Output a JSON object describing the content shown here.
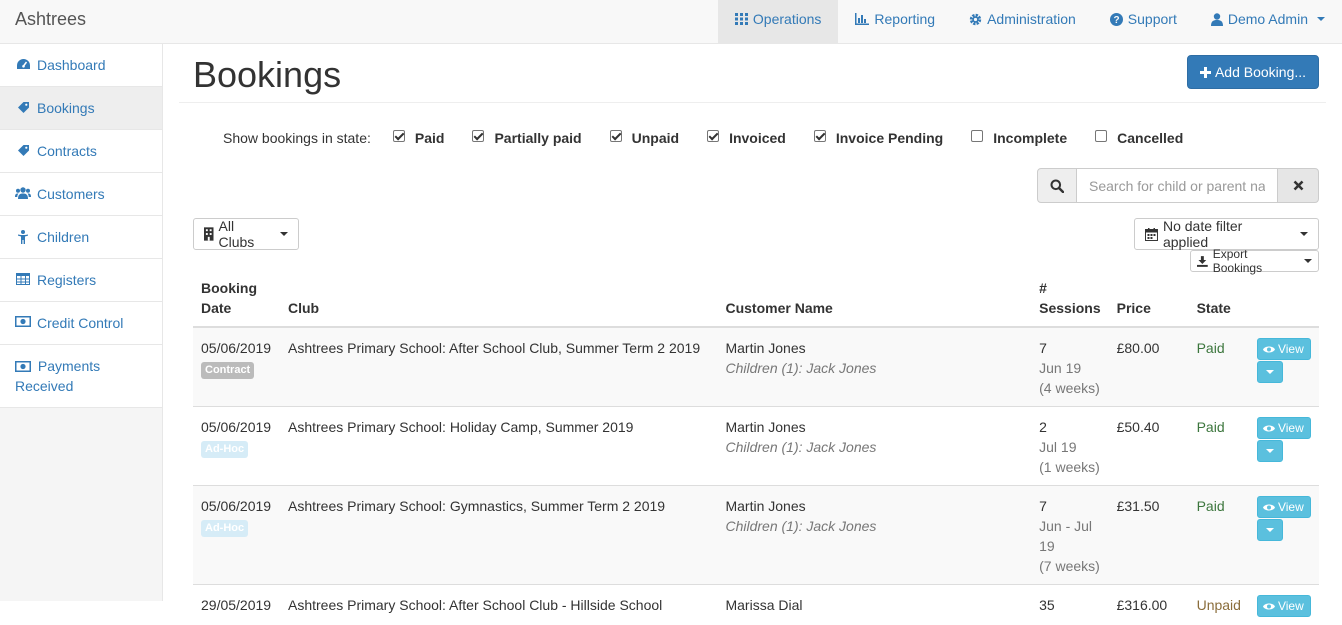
{
  "app": {
    "brand": "Ashtrees"
  },
  "nav": {
    "items": [
      {
        "label": "Operations",
        "icon": "grid-icon",
        "active": true
      },
      {
        "label": "Reporting",
        "icon": "bar-chart-icon"
      },
      {
        "label": "Administration",
        "icon": "gear-icon"
      },
      {
        "label": "Support",
        "icon": "question-circle-icon"
      },
      {
        "label": "Demo Admin",
        "icon": "user-icon"
      }
    ]
  },
  "sidebar": {
    "items": [
      {
        "label": "Dashboard",
        "icon": "dashboard-icon"
      },
      {
        "label": "Bookings",
        "icon": "tag-icon",
        "active": true
      },
      {
        "label": "Contracts",
        "icon": "tags-icon"
      },
      {
        "label": "Customers",
        "icon": "users-icon"
      },
      {
        "label": "Children",
        "icon": "child-icon"
      },
      {
        "label": "Registers",
        "icon": "table-icon"
      },
      {
        "label": "Credit Control",
        "icon": "money-icon"
      },
      {
        "label": "Payments Received",
        "icon": "money-icon"
      }
    ]
  },
  "page": {
    "title": "Bookings",
    "add_button": "Add Booking...",
    "filter_label": "Show bookings in state:",
    "states": [
      {
        "label": "Paid",
        "checked": true
      },
      {
        "label": "Partially paid",
        "checked": true
      },
      {
        "label": "Unpaid",
        "checked": true
      },
      {
        "label": "Invoiced",
        "checked": true
      },
      {
        "label": "Invoice Pending",
        "checked": true
      },
      {
        "label": "Incomplete",
        "checked": false
      },
      {
        "label": "Cancelled",
        "checked": false
      }
    ],
    "search_placeholder": "Search for child or parent na",
    "clubs_button": "All Clubs",
    "date_filter_button": "No date filter applied",
    "export_button": "Export Bookings"
  },
  "table": {
    "headers": {
      "booking_date_1": "Booking",
      "booking_date_2": "Date",
      "club": "Club",
      "customer": "Customer Name",
      "sessions_1": "#",
      "sessions_2": "Sessions",
      "price": "Price",
      "state": "State"
    },
    "view_label": "View",
    "rows": [
      {
        "date": "05/06/2019",
        "tag": "Contract",
        "club": "Ashtrees Primary School: After School Club, Summer Term 2 2019",
        "customer": "Martin Jones",
        "children": "Children (1): Jack Jones",
        "sessions": "7",
        "period": "Jun 19",
        "period2": "",
        "weeks": "(4 weeks)",
        "price": "£80.00",
        "state": "Paid"
      },
      {
        "date": "05/06/2019",
        "tag": "Ad-Hoc",
        "club": "Ashtrees Primary School: Holiday Camp, Summer 2019",
        "customer": "Martin Jones",
        "children": "Children (1): Jack Jones",
        "sessions": "2",
        "period": "Jul 19",
        "period2": "",
        "weeks": "(1 weeks)",
        "price": "£50.40",
        "state": "Paid"
      },
      {
        "date": "05/06/2019",
        "tag": "Ad-Hoc",
        "club": "Ashtrees Primary School: Gymnastics, Summer Term 2 2019",
        "customer": "Martin Jones",
        "children": "Children (1): Jack Jones",
        "sessions": "7",
        "period": "Jun - Jul",
        "period2": "19",
        "weeks": "(7 weeks)",
        "price": "£31.50",
        "state": "Paid"
      },
      {
        "date": "29/05/2019",
        "tag": "",
        "club": "Ashtrees Primary School: After School Club - Hillside School",
        "customer": "Marissa Dial",
        "children": "",
        "sessions": "35",
        "period": "",
        "period2": "",
        "weeks": "",
        "price": "£316.00",
        "state": "Unpaid"
      }
    ]
  },
  "colors": {
    "link": "#337ab7",
    "primary": "#337ab7",
    "info": "#5bc0de",
    "paid": "#3c763d",
    "unpaid": "#8a6d3b"
  }
}
